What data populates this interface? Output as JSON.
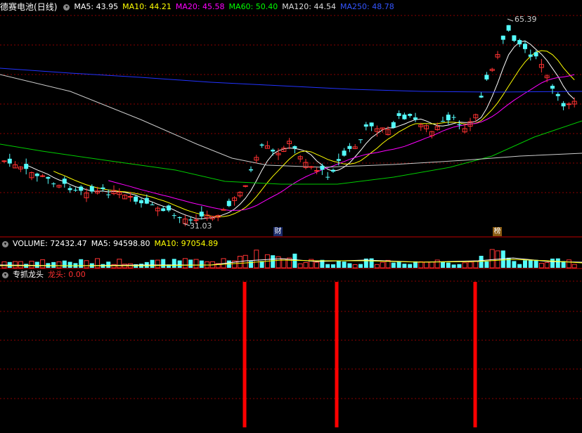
{
  "header": {
    "stock_name": "德赛电池",
    "period": "(日线)",
    "ma": [
      {
        "label": "MA5: 43.95",
        "color": "#ffffff"
      },
      {
        "label": "MA10: 44.21",
        "color": "#ffff00"
      },
      {
        "label": "MA20: 45.58",
        "color": "#ff00ff"
      },
      {
        "label": "MA60: 50.40",
        "color": "#00ff00"
      },
      {
        "label": "MA120: 44.54",
        "color": "#dddddd"
      },
      {
        "label": "MA250: 48.78",
        "color": "#3355ff"
      }
    ]
  },
  "price_panel": {
    "high_label": "65.39",
    "low_label": "31.03",
    "marker_cai": "财",
    "marker_bang": "榜"
  },
  "volume_panel": {
    "title": "VOLUME: 72432.47",
    "ma5": "MA5: 94598.80",
    "ma10": "MA10: 97054.89"
  },
  "indicator_panel": {
    "title": "专抓龙头",
    "series_label": "龙头: 0.00"
  },
  "colors": {
    "up": "#ff3232",
    "down": "#54fcfc",
    "grid": "#8b0000",
    "signal": "#ff0000"
  }
}
